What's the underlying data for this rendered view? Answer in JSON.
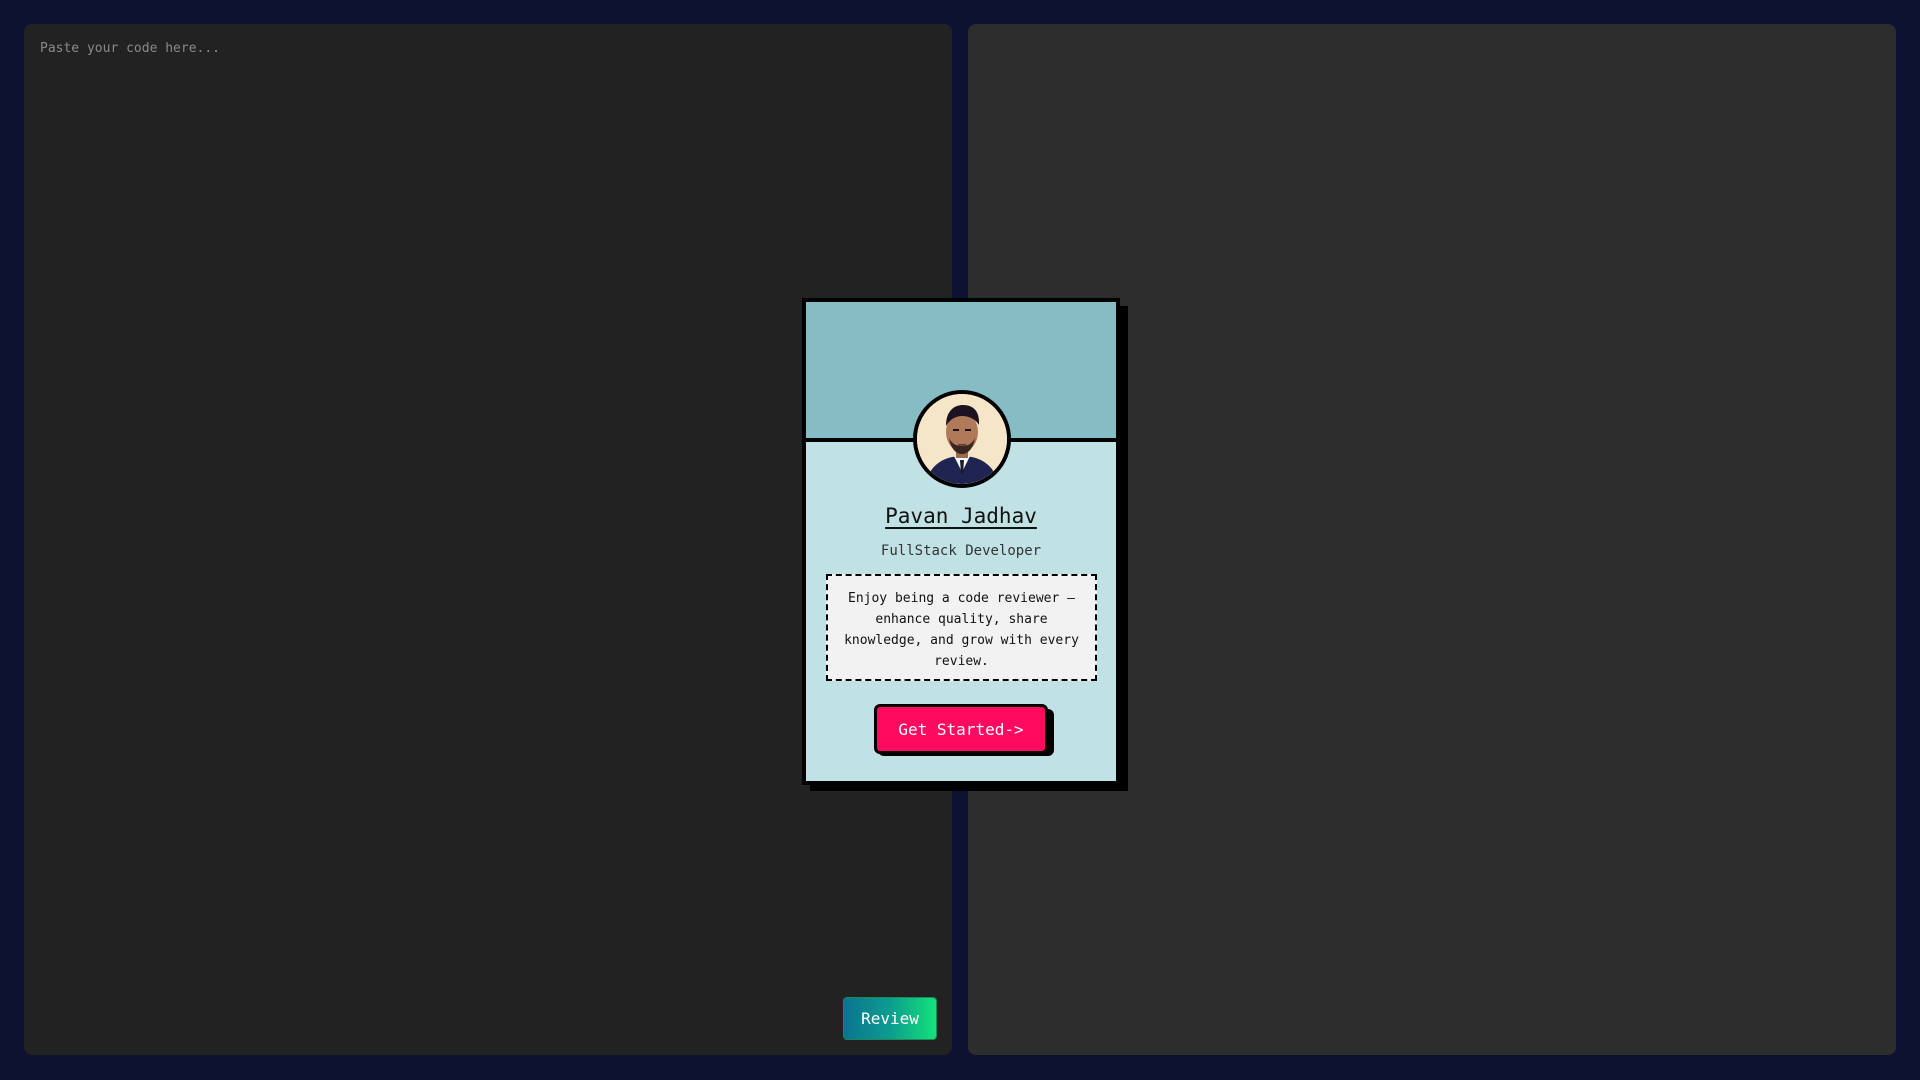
{
  "editor": {
    "placeholder": "Paste your code here...",
    "review_label": "Review"
  },
  "profile_card": {
    "name": "Pavan Jadhav",
    "role": "FullStack Developer",
    "bio": "Enjoy being a code reviewer — enhance quality, share knowledge, and grow with every review.",
    "cta_label": "Get Started->",
    "colors": {
      "header": "#86bdc4",
      "body": "#c1e2e5",
      "cta": "#ff0a5f"
    },
    "avatar_icon": "profile-photo"
  },
  "theme": {
    "background": "#0d1230",
    "left_panel": "#222222",
    "right_panel": "#2d2d2d",
    "review_gradient": [
      "#0b7491",
      "#14e27a"
    ]
  }
}
